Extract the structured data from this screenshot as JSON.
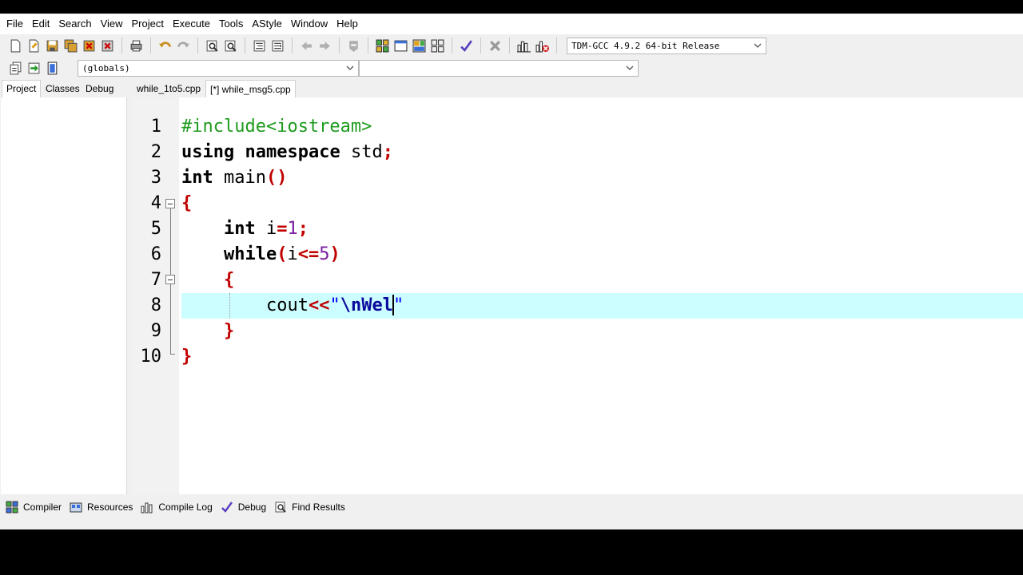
{
  "menu": [
    "File",
    "Edit",
    "Search",
    "View",
    "Project",
    "Execute",
    "Tools",
    "AStyle",
    "Window",
    "Help"
  ],
  "toolbar": {
    "compiler": "TDM-GCC 4.9.2 64-bit Release",
    "scope": "(globals)",
    "symbol": ""
  },
  "project_tabs": [
    "Project",
    "Classes",
    "Debug"
  ],
  "editor_tabs": [
    "while_1to5.cpp",
    "[*] while_msg5.cpp"
  ],
  "editor": {
    "line_numbers": [
      "1",
      "2",
      "3",
      "4",
      "5",
      "6",
      "7",
      "8",
      "9",
      "10"
    ],
    "current_line": 8
  },
  "code_tokens": {
    "l1_include": "#include<iostream>",
    "l2_using": "using",
    "l2_namespace": "namespace",
    "l2_std": " std",
    "l2_semi": ";",
    "l3_int": "int",
    "l3_main": " main",
    "l3_parens": "()",
    "l4_brace": "{",
    "l5_int": "int",
    "l5_i": " i",
    "l5_eq": "=",
    "l5_one": "1",
    "l5_semi": ";",
    "l6_while": "while",
    "l6_open": "(",
    "l6_i": "i",
    "l6_le": "<=",
    "l6_five": "5",
    "l6_close": ")",
    "l7_brace": "{",
    "l8_cout": "cout",
    "l8_shift": "<<",
    "l8_q1": "\"",
    "l8_esc": "\\nWel",
    "l8_q2": "\"",
    "l9_brace": "}",
    "l10_brace": "}"
  },
  "bottom_tabs": [
    "Compiler",
    "Resources",
    "Compile Log",
    "Debug",
    "Find Results"
  ],
  "colors": {
    "current_line": "#ccfdff",
    "keyword": "#000000",
    "preprocessor": "#1e9b1e",
    "symbol": "#c00000",
    "number": "#7a1ea0",
    "string": "#0000ff"
  }
}
